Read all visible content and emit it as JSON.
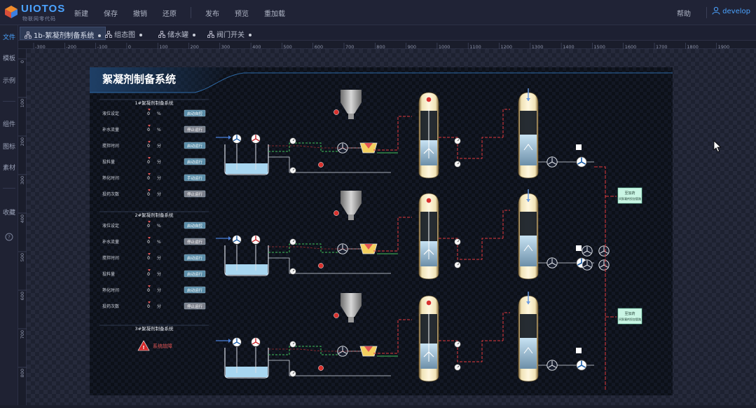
{
  "app": {
    "logo_text": "UIOTOS",
    "logo_sub": "物联网零代码",
    "menu": [
      "新建",
      "保存",
      "撤销",
      "还原",
      "发布",
      "预览",
      "重加载"
    ],
    "help": "帮助",
    "user": "develop"
  },
  "leftbar": {
    "items": [
      "文件",
      "模板",
      "示例",
      "组件",
      "图标",
      "素材",
      "收藏"
    ]
  },
  "tabs": [
    "1b-絮凝剂制备系统",
    "组态图",
    "储水罐",
    "阀门开关"
  ],
  "ruler": {
    "h_labels": [
      "-300",
      "-200",
      "-100",
      "0",
      "100",
      "200",
      "300",
      "400",
      "500",
      "600",
      "700",
      "800",
      "900",
      "1000",
      "1100",
      "1200",
      "1300",
      "1400",
      "1500",
      "1600",
      "1700",
      "1800",
      "1900"
    ],
    "v_labels": [
      "0",
      "100",
      "200",
      "300",
      "400",
      "500",
      "600",
      "700",
      "800"
    ]
  },
  "diagram": {
    "title": "絮凝剂制备系统",
    "systems": [
      {
        "heading": "1#絮凝剂制备系统",
        "rows": [
          {
            "label": "液位设定",
            "value": "0",
            "unit": "%",
            "btn": "启动自控"
          },
          {
            "label": "补水流量",
            "value": "0",
            "unit": "%",
            "btn": "停止运行"
          },
          {
            "label": "搅拌时间",
            "value": "0",
            "unit": "分",
            "btn": "启动运行"
          },
          {
            "label": "投料量",
            "value": "0",
            "unit": "分",
            "btn": "启动运行"
          },
          {
            "label": "熟化时间",
            "value": "0",
            "unit": "分",
            "btn": "手动运行"
          },
          {
            "label": "投药次数",
            "value": "0",
            "unit": "分",
            "btn": "停止运行"
          }
        ]
      },
      {
        "heading": "2#絮凝剂制备系统",
        "rows": [
          {
            "label": "液位设定",
            "value": "0",
            "unit": "%",
            "btn": "启动自控"
          },
          {
            "label": "补水流量",
            "value": "0",
            "unit": "%",
            "btn": "停止运行"
          },
          {
            "label": "搅拌时间",
            "value": "0",
            "unit": "分",
            "btn": "启动运行"
          },
          {
            "label": "投料量",
            "value": "0",
            "unit": "分",
            "btn": "启动运行"
          },
          {
            "label": "熟化时间",
            "value": "0",
            "unit": "分",
            "btn": "启动运行"
          },
          {
            "label": "投药次数",
            "value": "0",
            "unit": "分",
            "btn": "停止运行"
          }
        ]
      },
      {
        "heading": "3#絮凝剂制备系统",
        "alarm": "系统故障"
      }
    ],
    "outputs": [
      "至加药间絮凝剂投加管路",
      "至加药间絮凝剂投加管路"
    ]
  },
  "colors": {
    "accent": "#4ba3ff",
    "pipe_red": "#e0393b",
    "pipe_green": "#3fbf5a",
    "tank_water": "#a8d6f0",
    "output_box": "#c9f5e4",
    "button_teal": "#5a8da8",
    "alarm_red": "#d42a2a"
  }
}
